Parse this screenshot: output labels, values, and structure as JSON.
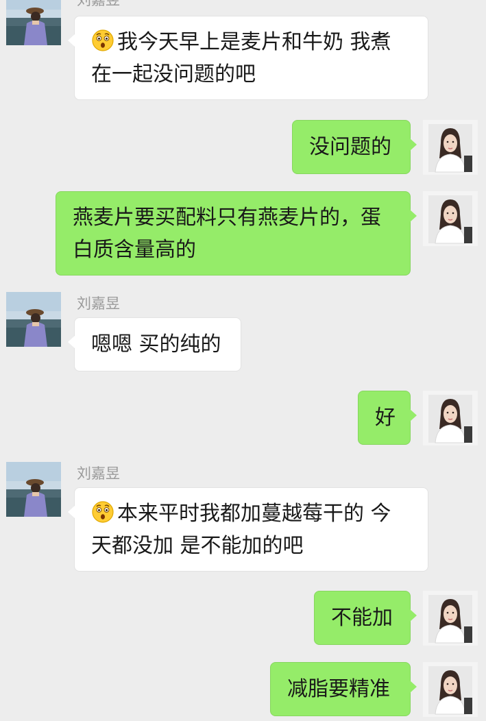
{
  "contact_name": "刘嘉昱",
  "messages": [
    {
      "side": "in",
      "sender": "刘嘉昱",
      "emoji": "surprised-face-icon",
      "lines": [
        "我今天早上是麦片和牛奶 我煮",
        "在一起没问题的吧"
      ]
    },
    {
      "side": "out",
      "lines": [
        "没问题的"
      ]
    },
    {
      "side": "out",
      "lines": [
        "燕麦片要买配料只有燕麦片的，蛋",
        "白质含量高的"
      ]
    },
    {
      "side": "in",
      "sender": "刘嘉昱",
      "lines": [
        "嗯嗯 买的纯的"
      ]
    },
    {
      "side": "out",
      "lines": [
        "好"
      ]
    },
    {
      "side": "in",
      "sender": "刘嘉昱",
      "emoji": "surprised-face-icon",
      "lines": [
        "本来平时我都加蔓越莓干的 今",
        "天都没加 是不能加的吧"
      ]
    },
    {
      "side": "out",
      "lines": [
        "不能加"
      ]
    },
    {
      "side": "out",
      "lines": [
        "减脂要精准"
      ]
    }
  ],
  "colors": {
    "background": "#ededed",
    "outgoing_bubble": "#95ec69",
    "incoming_bubble": "#ffffff",
    "sender_name": "#9a9a9a"
  }
}
